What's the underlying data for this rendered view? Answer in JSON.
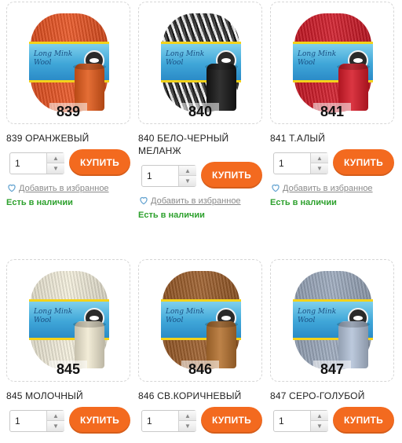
{
  "products": [
    {
      "title": "839 ОРАНЖЕВЫЙ",
      "code": "839",
      "yarn_color": "#e8501e",
      "spool_color": "#e15a1a",
      "skein_stripes": false,
      "qty": "1",
      "buy_label": "КУПИТЬ",
      "fav_label": "Добавить в избранное",
      "stock_label": "Есть в наличии",
      "band_text": "Long Mink Wool"
    },
    {
      "title": "840 БЕЛО-ЧЕРНЫЙ МЕЛАНЖ",
      "code": "840",
      "yarn_color": "#3a3a3a",
      "spool_color": "#161616",
      "skein_stripes": true,
      "qty": "1",
      "buy_label": "КУПИТЬ",
      "fav_label": "Добавить в избранное",
      "stock_label": "Есть в наличии",
      "band_text": "Long Mink Wool"
    },
    {
      "title": "841 Т.АЛЫЙ",
      "code": "841",
      "yarn_color": "#cf1624",
      "spool_color": "#d61a28",
      "skein_stripes": false,
      "qty": "1",
      "buy_label": "КУПИТЬ",
      "fav_label": "Добавить в избранное",
      "stock_label": "Есть в наличии",
      "band_text": "Long Mink Wool"
    },
    {
      "title": "845 МОЛОЧНЫЙ",
      "code": "845",
      "yarn_color": "#f4efdc",
      "spool_color": "#f1ead2",
      "skein_stripes": false,
      "qty": "1",
      "buy_label": "КУПИТЬ",
      "band_text": "Long Mink Wool"
    },
    {
      "title": "846 СВ.КОРИЧНЕВЫЙ",
      "code": "846",
      "yarn_color": "#9a5a26",
      "spool_color": "#b4712f",
      "skein_stripes": false,
      "qty": "1",
      "buy_label": "КУПИТЬ",
      "band_text": "Long Mink Wool"
    },
    {
      "title": "847 СЕРО-ГОЛУБОЙ",
      "code": "847",
      "yarn_color": "#9aa8bc",
      "spool_color": "#b3c2d8",
      "skein_stripes": false,
      "qty": "1",
      "buy_label": "КУПИТЬ",
      "band_text": "Long Mink Wool"
    }
  ],
  "colors": {
    "buy_button": "#f36a1f",
    "in_stock": "#2ea12e",
    "favorite_link": "#8a8a8a"
  },
  "icons": {
    "favorite": "heart-outline-icon",
    "qty_up": "chevron-up-icon",
    "qty_down": "chevron-down-icon"
  }
}
